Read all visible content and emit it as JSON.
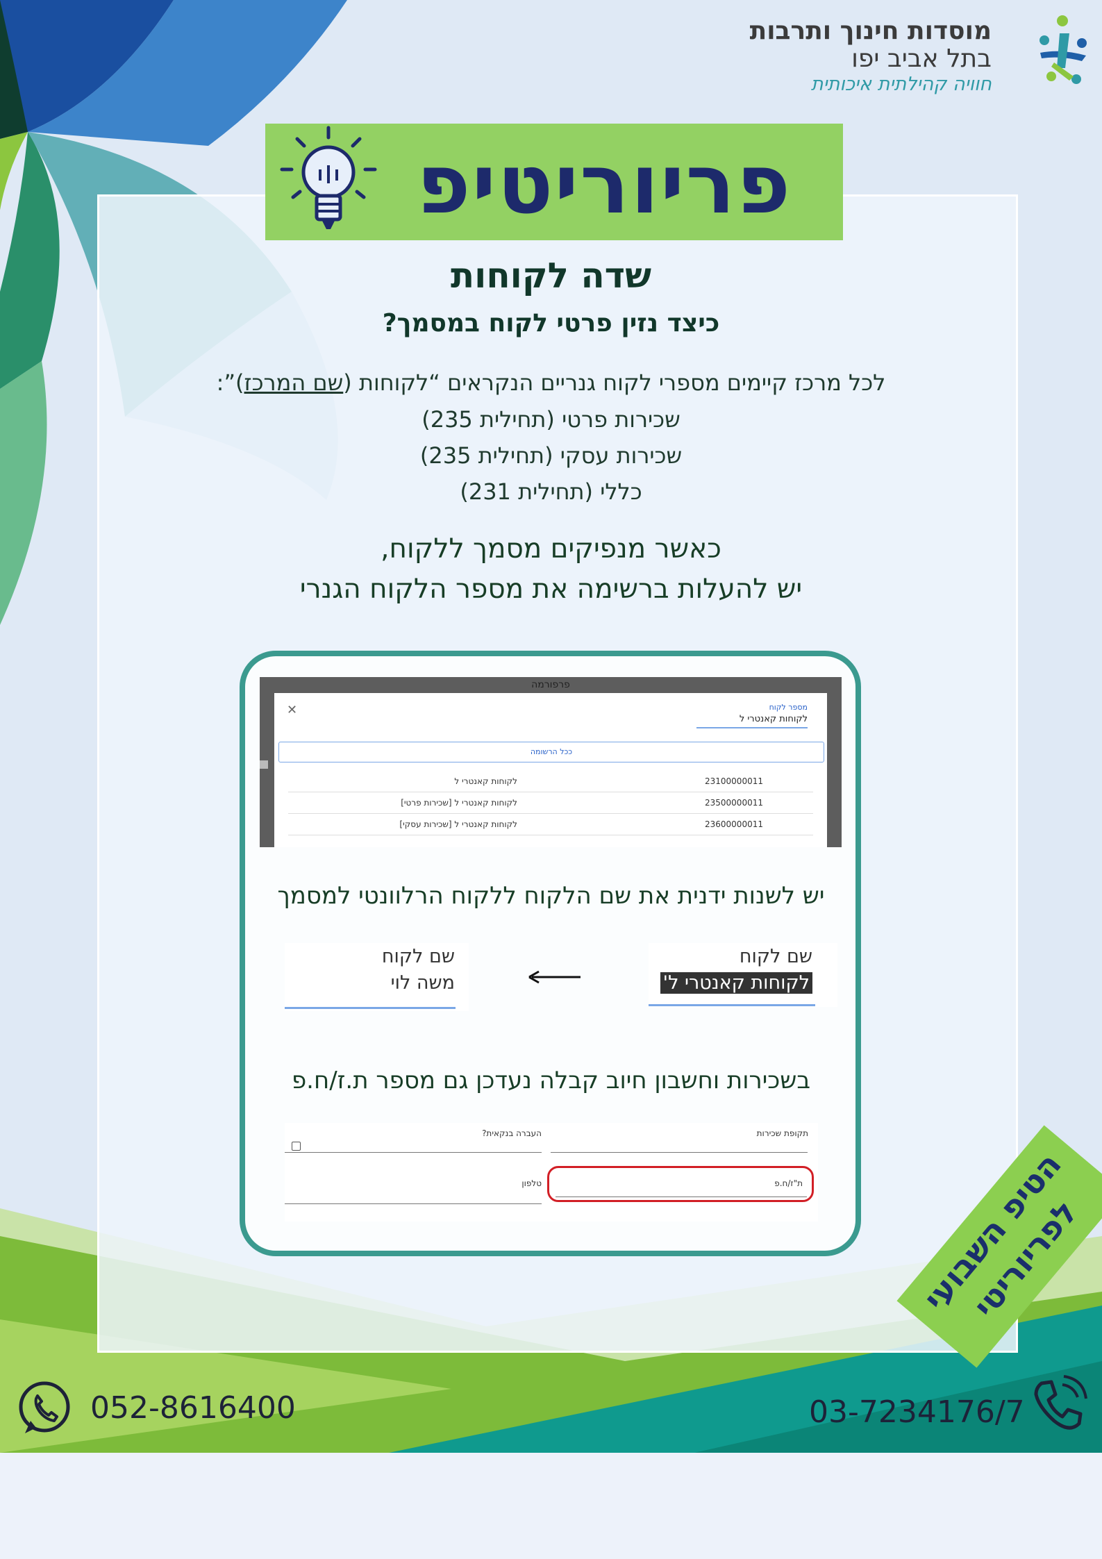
{
  "org": {
    "title": "מוסדות חינוך ותרבות",
    "subtitle": "בתל אביב יפו",
    "tagline": "חוויה קהילתית איכותית",
    "logo_icon": "people-logo-icon"
  },
  "banner": {
    "title": "פריוריטיפ",
    "icon": "lightbulb-icon"
  },
  "heading": "שדה לקוחות",
  "subheading": "כיצד נזין פרטי לקוח במסמך?",
  "intro": {
    "line1_pre": "לכל מרכז קיימים מספרי לקוח גנריים הנקראים “לקוחות (",
    "line1_link": "שם המרכז",
    "line1_post": ")”:",
    "items": [
      "שכירות פרטי (תחילית 235)",
      "שכירות עסקי (תחילית 235)",
      "כללי (תחילית 231)"
    ]
  },
  "emphasis": {
    "line1": "כאשר מנפיקים מסמך ללקוח,",
    "line2": "יש להעלות ברשימה את מספר הלקוח הגנרי"
  },
  "screenshot1": {
    "window_title": "פרפורמה",
    "field_label": "מספר לקוח",
    "field_value": "לקוחות קאנטרי ל",
    "button": "ככל הרשומה",
    "rows": [
      {
        "number": "23100000011",
        "name": "לקוחות קאנטרי ל"
      },
      {
        "number": "23500000011",
        "name": "לקוחות קאנטרי ל [שכירות פרטי]"
      },
      {
        "number": "23600000011",
        "name": "לקוחות קאנטרי ל [שכירות עסקי]"
      }
    ]
  },
  "caption2": "יש לשנות ידנית את שם הלקוח ללקוח הרלוונטי למסמך",
  "before_field": {
    "label": "שם לקוח",
    "value": "לקוחות קאנטרי ל'"
  },
  "after_field": {
    "label": "שם לקוח",
    "value": "משה לוי"
  },
  "caption3": "בשכירות וחשבון חיוב קבלה נעדכן גם מספר ת.ז/ח.פ",
  "screenshot3": {
    "rental_period": "תקופת שכירות",
    "bank_transfer": "העברה בנקאית?",
    "id_field": "ת\"ז/ח.פ",
    "phone_field": "טלפון"
  },
  "tip_badge": {
    "line1": "הטיפ השבועי",
    "line2": "לפריוריטי"
  },
  "contact": {
    "whatsapp": "052-8616400",
    "phone": "03-7234176/7"
  },
  "colors": {
    "banner_green": "#93d163",
    "frame_teal": "#3b9a8f",
    "dark_green": "#11372a",
    "navy": "#1d2a6b",
    "highlight_red": "#d21f26"
  }
}
